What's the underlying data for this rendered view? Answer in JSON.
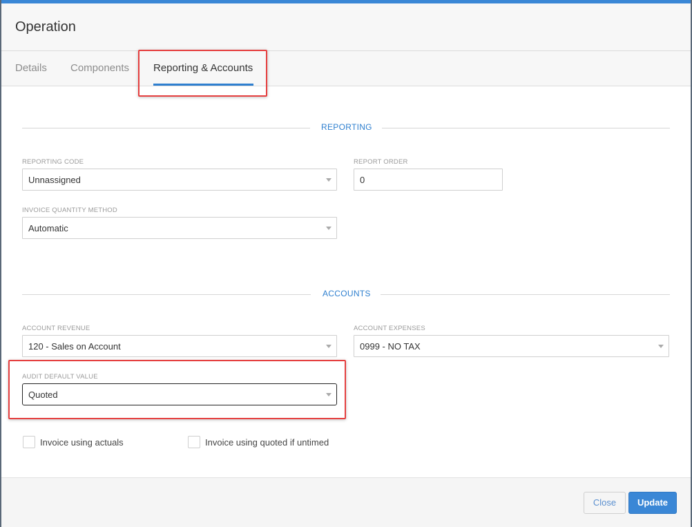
{
  "dialog": {
    "title": "Operation"
  },
  "tabs": [
    {
      "label": "Details",
      "active": false
    },
    {
      "label": "Components",
      "active": false
    },
    {
      "label": "Reporting & Accounts",
      "active": true
    }
  ],
  "reporting": {
    "section_title": "REPORTING",
    "reporting_code": {
      "label": "REPORTING CODE",
      "value": "Unnassigned"
    },
    "report_order": {
      "label": "REPORT ORDER",
      "value": "0"
    },
    "invoice_quantity_method": {
      "label": "INVOICE QUANTITY METHOD",
      "value": "Automatic"
    }
  },
  "accounts": {
    "section_title": "ACCOUNTS",
    "account_revenue": {
      "label": "ACCOUNT REVENUE",
      "value": "120 - Sales on Account"
    },
    "account_expenses": {
      "label": "ACCOUNT EXPENSES",
      "value": "0999 - NO TAX"
    },
    "audit_default_value": {
      "label": "AUDIT DEFAULT VALUE",
      "value": "Quoted"
    },
    "invoice_using_actuals": {
      "label": "Invoice using actuals",
      "checked": false
    },
    "invoice_using_quoted": {
      "label": "Invoice using quoted if untimed",
      "checked": false
    }
  },
  "footer": {
    "close_label": "Close",
    "update_label": "Update"
  },
  "colors": {
    "accent": "#3a87d6",
    "highlight": "#e53e3e"
  }
}
